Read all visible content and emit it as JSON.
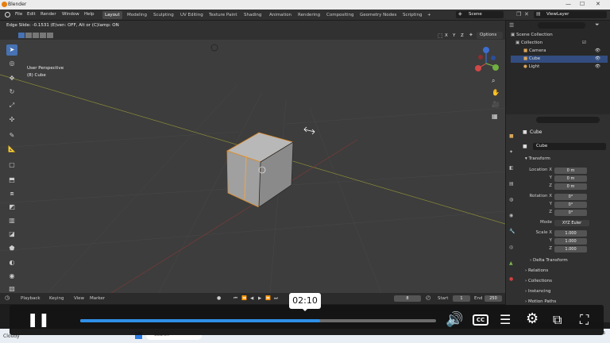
{
  "window": {
    "title": "Blender",
    "min": "—",
    "max": "☐",
    "close": "✕"
  },
  "menubar": {
    "items": [
      "File",
      "Edit",
      "Render",
      "Window",
      "Help"
    ],
    "workspaces": [
      "Layout",
      "Modeling",
      "Sculpting",
      "UV Editing",
      "Texture Paint",
      "Shading",
      "Animation",
      "Rendering",
      "Compositing",
      "Geometry Nodes",
      "Scripting"
    ],
    "add_tab": "+",
    "scene": "Scene",
    "view_layer": "ViewLayer"
  },
  "viewport": {
    "status_text": "Edge Slide: -0.1531 (E)ven: OFF, Alt or (C)lamp: ON",
    "perspective": "User Perspective",
    "object_label": "(8) Cube",
    "options": "Options",
    "axes": [
      "X",
      "Y",
      "Z"
    ]
  },
  "outliner": {
    "root": "Scene Collection",
    "collection": "Collection",
    "items": [
      "Camera",
      "Cube",
      "Light"
    ]
  },
  "properties": {
    "object_name": "Cube",
    "data_name": "Cube",
    "transform_header": "Transform",
    "location": {
      "label": "Location X",
      "y": "Y",
      "z": "Z",
      "values": [
        "0 m",
        "0 m",
        "0 m"
      ]
    },
    "rotation": {
      "label": "Rotation X",
      "y": "Y",
      "z": "Z",
      "values": [
        "0°",
        "0°",
        "0°"
      ]
    },
    "mode": {
      "label": "Mode",
      "value": "XYZ Euler"
    },
    "scale": {
      "label": "Scale X",
      "y": "Y",
      "z": "Z",
      "values": [
        "1.000",
        "1.000",
        "1.000"
      ]
    },
    "delta": "Delta Transform",
    "sections": [
      "Relations",
      "Collections",
      "Instancing",
      "Motion Paths"
    ]
  },
  "timeline": {
    "menus": [
      "Playback",
      "Keying",
      "View",
      "Marker"
    ],
    "frame": "8",
    "start_label": "Start",
    "start": "1",
    "end_label": "End",
    "end": "250"
  },
  "player": {
    "time": "02:10",
    "progress": 0.673
  },
  "taskbar": {
    "weather": "Cloudy",
    "temp": "23",
    "search": "Search"
  }
}
